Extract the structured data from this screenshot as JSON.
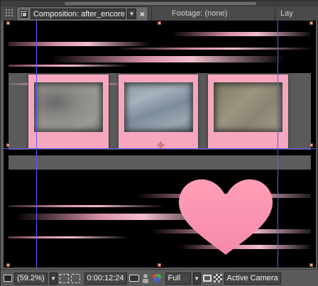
{
  "tabs": {
    "composition_label": "Composition: after_encore",
    "footage_label": "Footage: (none)",
    "layer_label": "Lay"
  },
  "toolbar": {
    "magnification": "(59.2%)",
    "timecode": "0:00:12:24",
    "resolution": "Full",
    "camera_view": "Active Camera"
  },
  "colors": {
    "polaroid_pink": "#f6a6bd",
    "guide_blue": "#5a5aff",
    "panel_gray": "#5e5e5e"
  },
  "icons": {
    "tab_grip": "grip-icon",
    "tab_lock": "lock-icon",
    "tab_close": "close-icon",
    "monitor": "monitor-icon",
    "grid": "grid-icon",
    "region": "region-of-interest-icon",
    "snapshot": "camera-icon",
    "show_snapshot": "person-icon",
    "channel": "rgb-channel-icon",
    "fast_previews": "frame-icon",
    "transparency_grid": "checkerboard-icon"
  }
}
